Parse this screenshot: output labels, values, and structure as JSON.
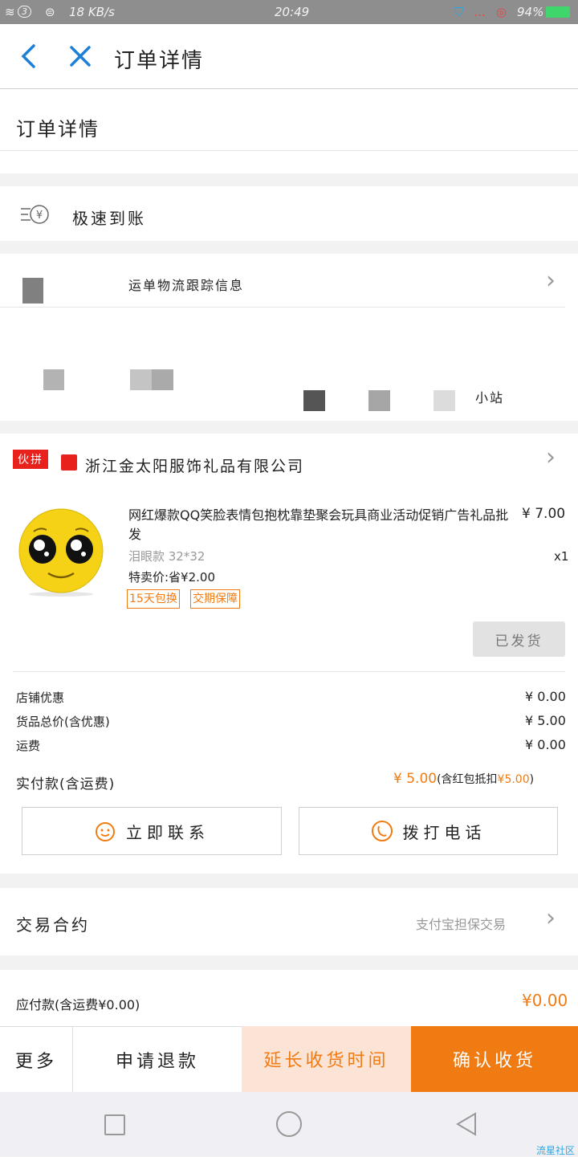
{
  "status_bar": {
    "signal_badge": "3",
    "speed": "18 KB/s",
    "time": "20:49",
    "battery": "94%"
  },
  "header": {
    "title": "订单详情"
  },
  "page_heading": "订单详情",
  "quick_refund": {
    "label": "极速到账"
  },
  "logistics": {
    "text": "运单物流跟踪信息",
    "station": "小站"
  },
  "shop": {
    "badge": "伙拼",
    "name": "浙江金太阳服饰礼品有限公司"
  },
  "product": {
    "title": "网红爆款QQ笑脸表情包抱枕靠垫聚会玩具商业活动促销广告礼品批发",
    "price": "¥ 7.00",
    "quantity": "x1",
    "spec": "泪眼款 32*32",
    "discount": "特卖价:省¥2.00",
    "tags": [
      "15天包换",
      "交期保障"
    ],
    "status_button": "已发货"
  },
  "summary": {
    "rows": [
      {
        "label": "店铺优惠",
        "value": "¥ 0.00"
      },
      {
        "label": "货品总价(含优惠)",
        "value": "¥ 5.00"
      },
      {
        "label": "运费",
        "value": "¥ 0.00"
      }
    ],
    "paid_label": "实付款(含运费)",
    "paid_value": "¥ 5.00",
    "paid_note_prefix": "(含红包抵扣",
    "paid_note_amount": "¥5.00",
    "paid_note_suffix": ")"
  },
  "contact": {
    "contact_now": "立即联系",
    "call": "拨打电话"
  },
  "contract": {
    "label": "交易合约",
    "value": "支付宝担保交易"
  },
  "payable": {
    "label": "应付款(含运费¥0.00)",
    "value": "¥0.00"
  },
  "actions": {
    "more": "更多",
    "refund": "申请退款",
    "extend": "延长收货时间",
    "confirm": "确认收货"
  },
  "watermark": "流星社区",
  "colors": {
    "accent": "#f07b13",
    "extend_bg": "#fbe4d5",
    "link_blue": "#1e7fd8"
  }
}
